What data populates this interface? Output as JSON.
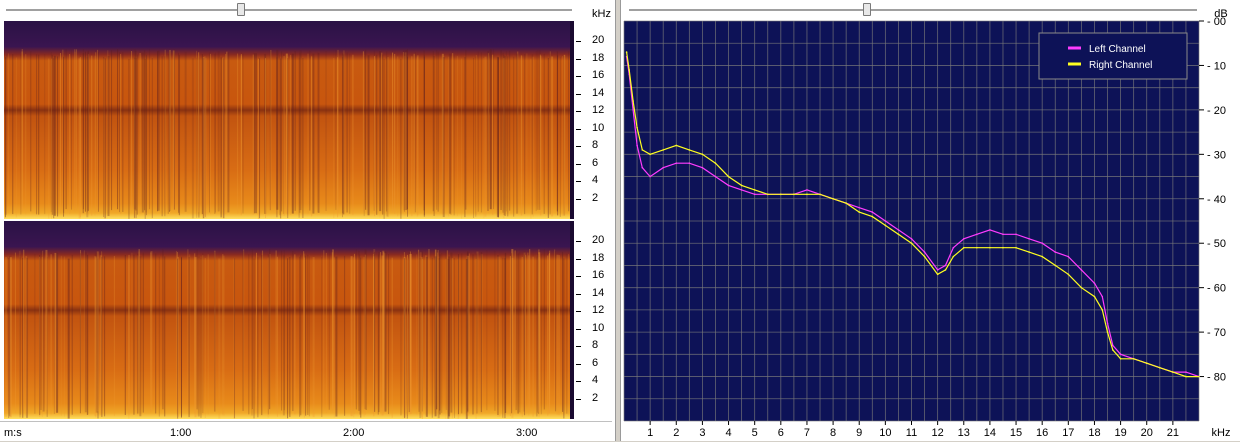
{
  "spectrogram": {
    "unit": "kHz",
    "freq_ticks": [
      "20",
      "18",
      "16",
      "14",
      "12",
      "10",
      "8",
      "6",
      "4",
      "2"
    ],
    "time_ticks": [
      "m:s",
      "1:00",
      "2:00",
      "3:00"
    ]
  },
  "chart_data": {
    "type": "line",
    "title": "",
    "xlabel": "kHz",
    "ylabel": "dB",
    "xlim": [
      0,
      22
    ],
    "ylim": [
      0,
      90
    ],
    "y_inverted": true,
    "grid": true,
    "legend_position": "top-right",
    "xticks": [
      "1",
      "2",
      "3",
      "4",
      "5",
      "6",
      "7",
      "8",
      "9",
      "10",
      "11",
      "12",
      "13",
      "14",
      "15",
      "16",
      "17",
      "18",
      "19",
      "20",
      "21"
    ],
    "yticks": [
      "00",
      "10",
      "20",
      "30",
      "40",
      "50",
      "60",
      "70",
      "80"
    ],
    "background": "#0d1257",
    "series": [
      {
        "name": "Left Channel",
        "color": "#ff3cff",
        "x": [
          0.1,
          0.2,
          0.35,
          0.5,
          0.7,
          1,
          1.5,
          2,
          2.5,
          3,
          3.5,
          4,
          4.5,
          5,
          5.5,
          6,
          6.5,
          7,
          7.5,
          8,
          8.5,
          9,
          9.5,
          10,
          10.5,
          11,
          11.5,
          12,
          12.3,
          12.6,
          13,
          13.5,
          14,
          14.5,
          15,
          15.5,
          16,
          16.5,
          17,
          17.5,
          18,
          18.3,
          18.5,
          18.7,
          19,
          19.5,
          20,
          20.5,
          21,
          21.5,
          22
        ],
        "y": [
          8,
          12,
          20,
          28,
          33,
          35,
          33,
          32,
          32,
          33,
          35,
          37,
          38,
          39,
          39,
          39,
          39,
          38,
          39,
          40,
          41,
          42,
          43,
          45,
          47,
          49,
          52,
          56,
          55,
          51,
          49,
          48,
          47,
          48,
          48,
          49,
          50,
          52,
          53,
          56,
          59,
          62,
          68,
          73,
          75,
          76,
          77,
          78,
          79,
          79,
          80
        ]
      },
      {
        "name": "Right Channel",
        "color": "#ffff20",
        "x": [
          0.1,
          0.2,
          0.35,
          0.5,
          0.7,
          1,
          1.5,
          2,
          2.5,
          3,
          3.5,
          4,
          4.5,
          5,
          5.5,
          6,
          6.5,
          7,
          7.5,
          8,
          8.5,
          9,
          9.5,
          10,
          10.5,
          11,
          11.5,
          12,
          12.3,
          12.6,
          13,
          13.5,
          14,
          14.5,
          15,
          15.5,
          16,
          16.5,
          17,
          17.5,
          18,
          18.3,
          18.5,
          18.7,
          19,
          19.5,
          20,
          20.5,
          21,
          21.5,
          22
        ],
        "y": [
          7,
          11,
          18,
          24,
          29,
          30,
          29,
          28,
          29,
          30,
          32,
          35,
          37,
          38,
          39,
          39,
          39,
          39,
          39,
          40,
          41,
          43,
          44,
          46,
          48,
          50,
          53,
          57,
          56,
          53,
          51,
          51,
          51,
          51,
          51,
          52,
          53,
          55,
          57,
          60,
          62,
          65,
          70,
          74,
          76,
          76,
          77,
          78,
          79,
          80,
          80
        ]
      }
    ]
  }
}
